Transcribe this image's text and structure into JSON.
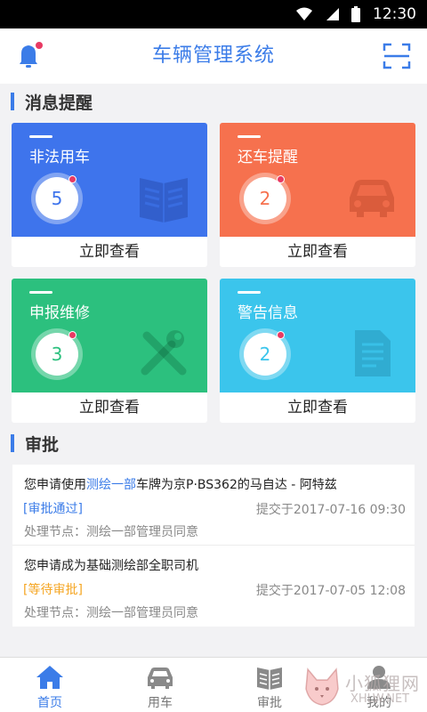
{
  "status_bar": {
    "time": "12:30"
  },
  "header": {
    "title": "车辆管理系统"
  },
  "messages_section": {
    "title": "消息提醒"
  },
  "cards": [
    {
      "label": "非法用车",
      "count": "5",
      "action": "立即查看",
      "color": "#3e74ec",
      "icon": "book-icon"
    },
    {
      "label": "还车提醒",
      "count": "2",
      "action": "立即查看",
      "color": "#f6714e",
      "icon": "car-icon"
    },
    {
      "label": "申报维修",
      "count": "3",
      "action": "立即查看",
      "color": "#2cc07e",
      "icon": "tools-icon"
    },
    {
      "label": "警告信息",
      "count": "2",
      "action": "立即查看",
      "color": "#3bc5ec",
      "icon": "document-icon"
    }
  ],
  "approval_section": {
    "title": "审批"
  },
  "approvals": [
    {
      "desc_prefix": "您申请使用",
      "desc_link": "测绘一部",
      "desc_suffix": "车牌为京P·BS362的马自达 - 阿特兹",
      "status": "[审批通过]",
      "submitted": "提交于2017-07-16 09:30",
      "node": "处理节点：测绘一部管理员同意"
    },
    {
      "desc_prefix": "您申请成为基础测绘部全职司机",
      "desc_link": "",
      "desc_suffix": "",
      "status": "[等待审批]",
      "submitted": "提交于2017-07-05 12:08",
      "node": "处理节点：测绘一部管理员同意"
    }
  ],
  "tabs": [
    {
      "label": "首页",
      "icon": "home-icon",
      "active": true
    },
    {
      "label": "用车",
      "icon": "car-icon",
      "active": false
    },
    {
      "label": "审批",
      "icon": "book-icon",
      "active": false
    },
    {
      "label": "我的",
      "icon": "user-icon",
      "active": false
    }
  ],
  "watermark": {
    "text": "小狐狸网",
    "url": "XHLW.NET"
  },
  "colors": {
    "accent": "#3b7ce8",
    "pending": "#f5a623",
    "badge": "#e83a63"
  }
}
